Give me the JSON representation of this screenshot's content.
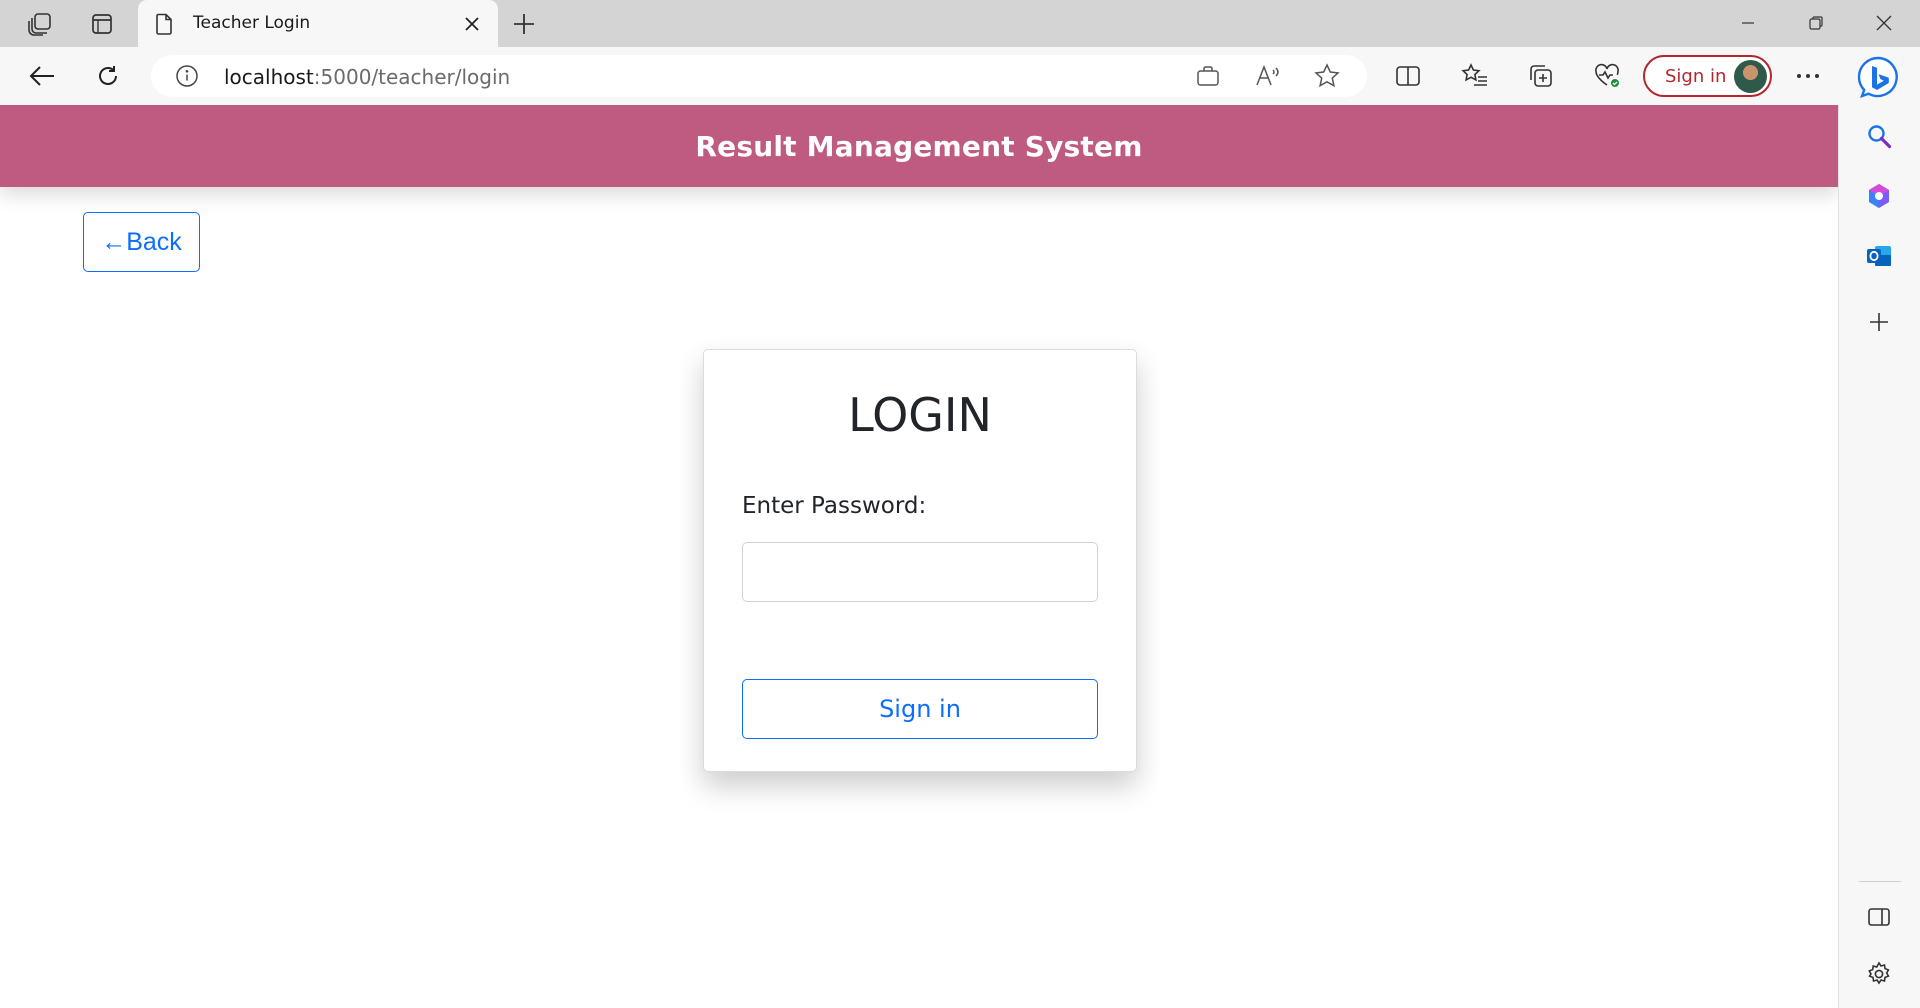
{
  "browser": {
    "tab": {
      "title": "Teacher Login"
    },
    "address_bar": {
      "host": "localhost",
      "path": ":5000/teacher/login"
    },
    "profile_button": {
      "label": "Sign in"
    }
  },
  "app": {
    "brand": "Result Management System",
    "back_button": "←Back",
    "login_card": {
      "heading": "LOGIN",
      "password_label": "Enter Password:",
      "password_value": "",
      "submit_label": "Sign in"
    }
  },
  "colors": {
    "navbar": "#bf5b81",
    "primary": "#0d6efd",
    "profile_outline": "#b3262e"
  }
}
